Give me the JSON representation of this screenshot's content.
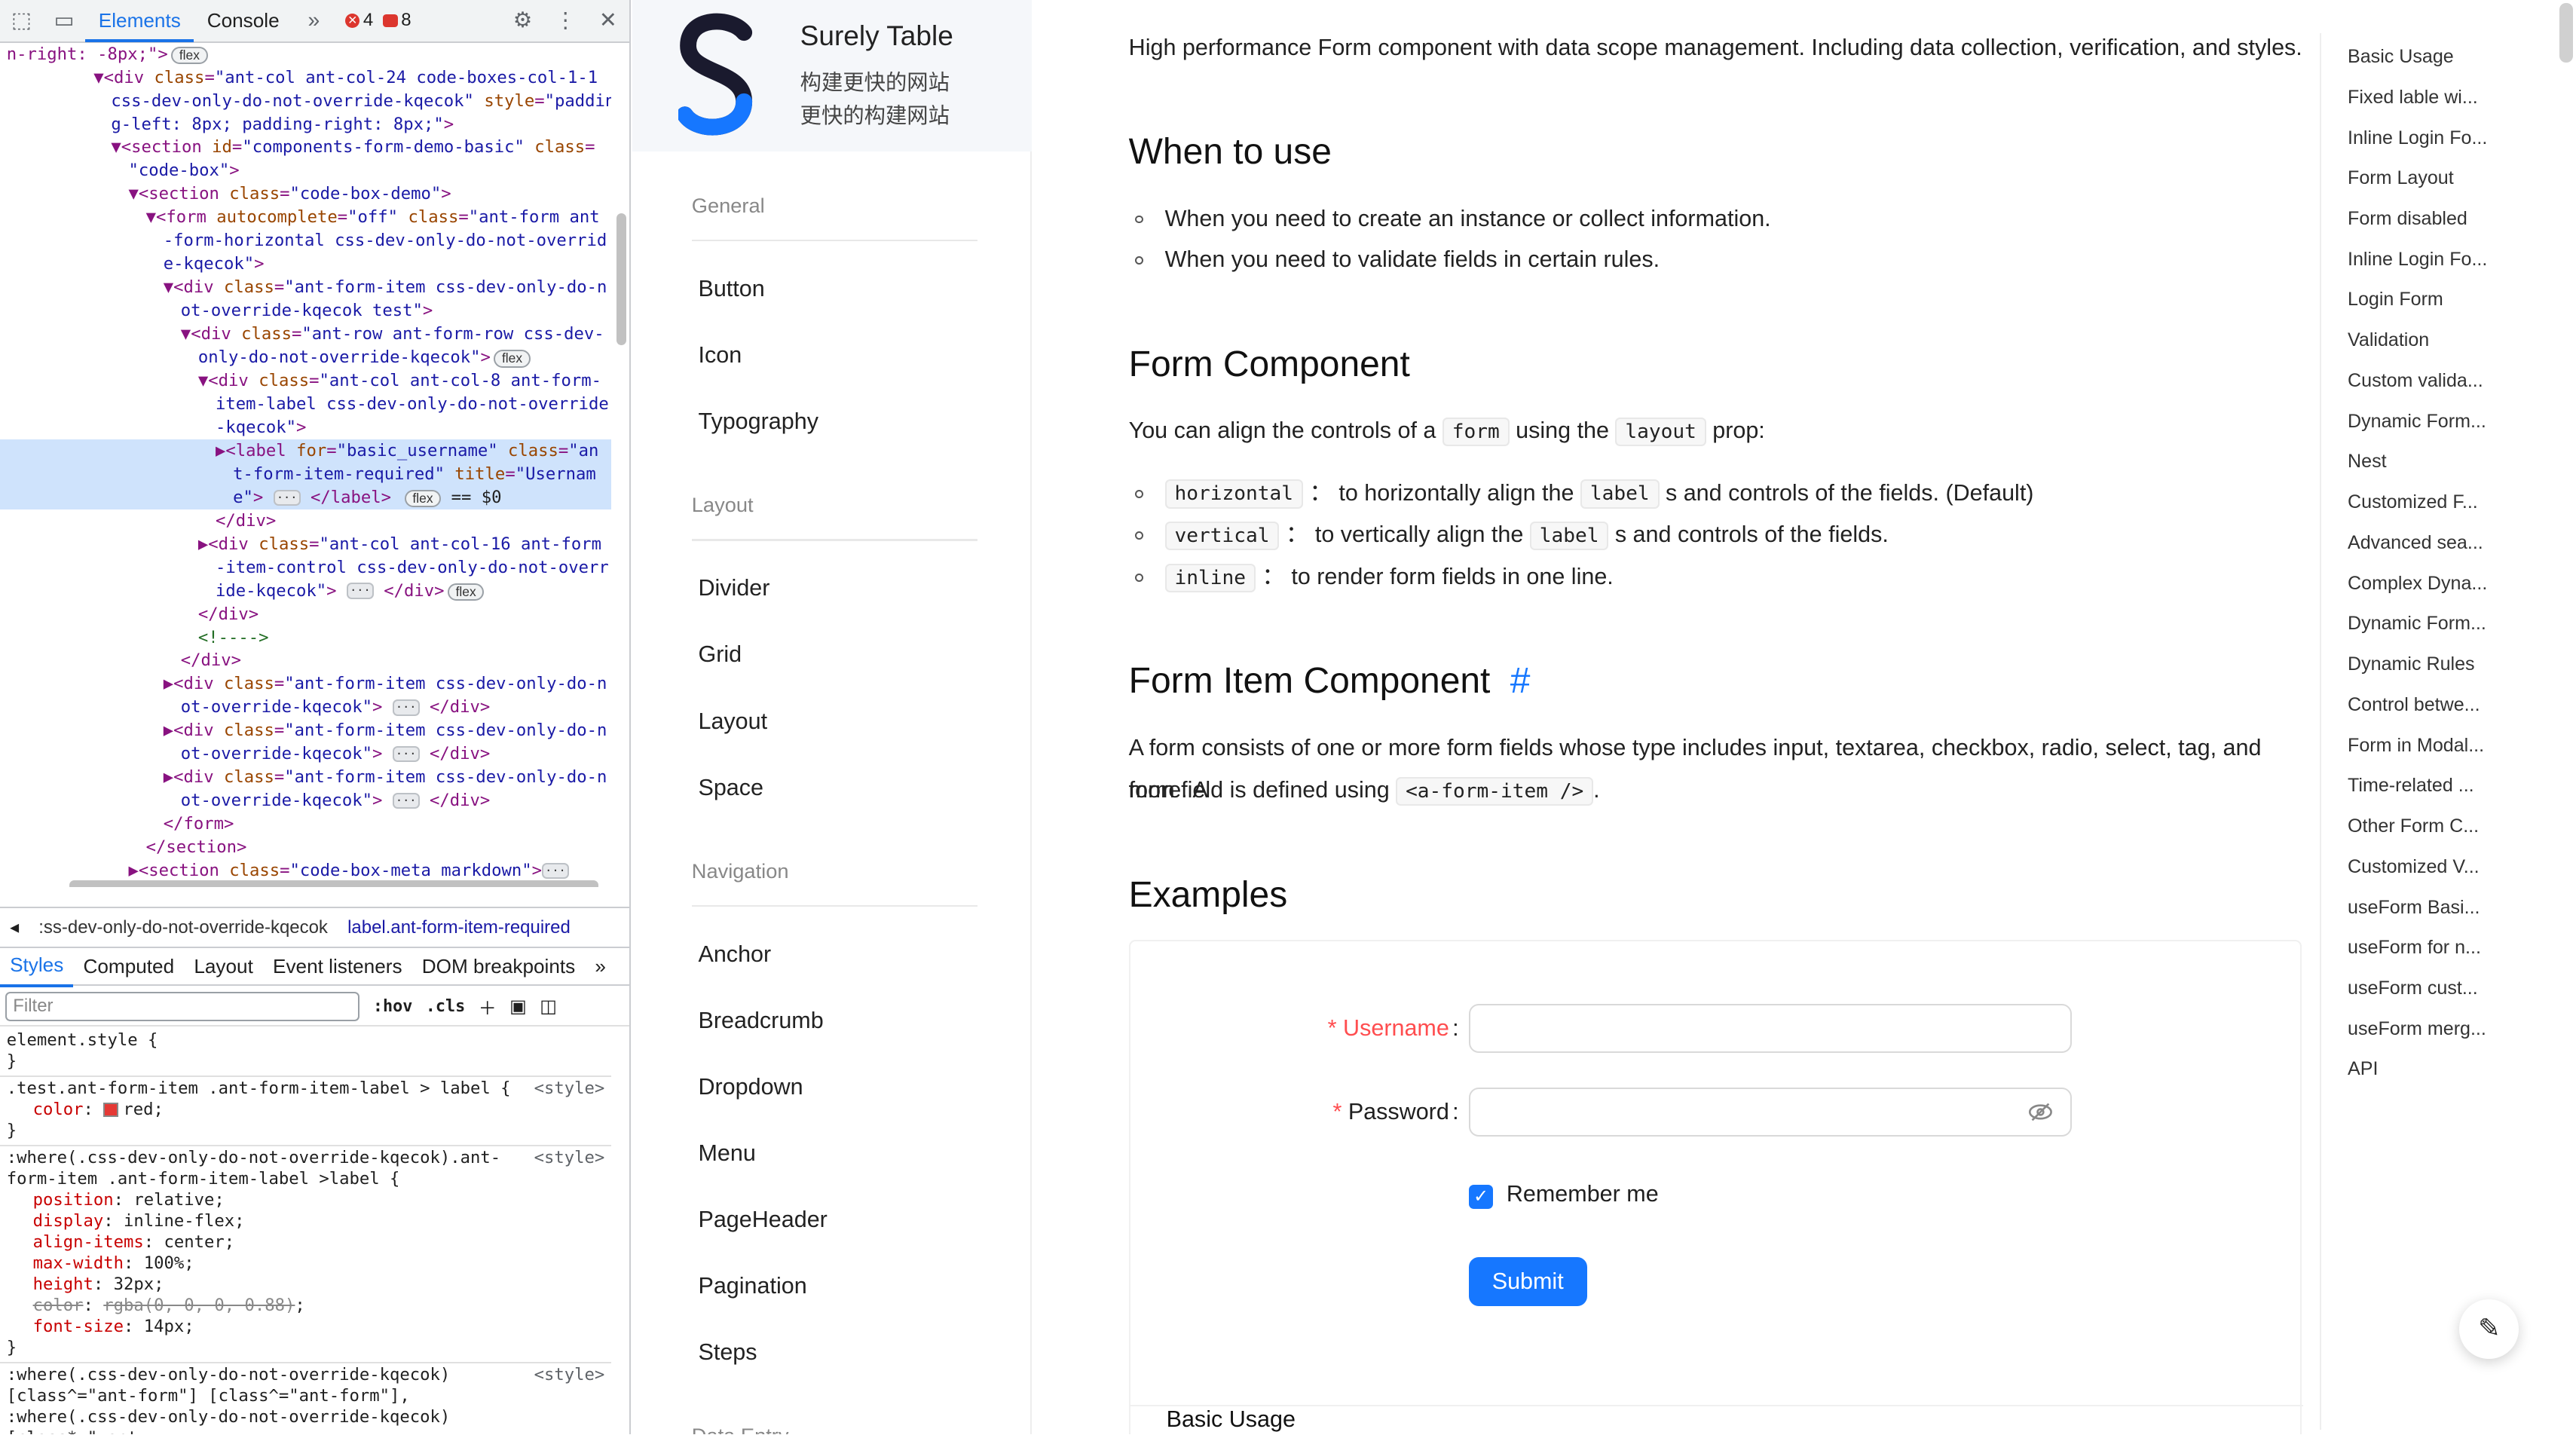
{
  "devtools": {
    "tabs": [
      "Elements",
      "Console"
    ],
    "more_tabs_icon": "»",
    "error_count": "4",
    "message_count": "8",
    "dom_lines": [
      {
        "indent": 0,
        "html": "<span class='tg'>n-right: -8px;\"></span><span class='pill'>flex</span>"
      },
      {
        "indent": 5,
        "html": "▼<span class='tg'>&lt;div</span> <span class='at'>class</span>=<span class='av'>\"ant-col ant-col-24 code-boxes-col-1-1</span>"
      },
      {
        "indent": 6,
        "html": "<span class='av'>css-dev-only-do-not-override-kqecok\"</span> <span class='at'>style</span>=<span class='av'>\"paddin</span>"
      },
      {
        "indent": 6,
        "html": "<span class='av'>g-left: 8px; padding-right: 8px;\"</span><span class='tg'>&gt;</span>"
      },
      {
        "indent": 6,
        "html": "▼<span class='tg'>&lt;section</span> <span class='at'>id</span>=<span class='av'>\"components-form-demo-basic\"</span> <span class='at'>class</span>="
      },
      {
        "indent": 7,
        "html": "<span class='av'>\"code-box\"</span><span class='tg'>&gt;</span>"
      },
      {
        "indent": 7,
        "html": "▼<span class='tg'>&lt;section</span> <span class='at'>class</span>=<span class='av'>\"code-box-demo\"</span><span class='tg'>&gt;</span>"
      },
      {
        "indent": 8,
        "html": "▼<span class='tg'>&lt;form</span> <span class='at'>autocomplete</span>=<span class='av'>\"off\"</span> <span class='at'>class</span>=<span class='av'>\"ant-form ant</span>"
      },
      {
        "indent": 9,
        "html": "<span class='av'>-form-horizontal css-dev-only-do-not-overrid</span>"
      },
      {
        "indent": 9,
        "html": "<span class='av'>e-kqecok\"</span><span class='tg'>&gt;</span>"
      },
      {
        "indent": 9,
        "html": "▼<span class='tg'>&lt;div</span> <span class='at'>class</span>=<span class='av'>\"ant-form-item css-dev-only-do-n</span>"
      },
      {
        "indent": 10,
        "html": "<span class='av'>ot-override-kqecok test\"</span><span class='tg'>&gt;</span>"
      },
      {
        "indent": 10,
        "html": "▼<span class='tg'>&lt;div</span> <span class='at'>class</span>=<span class='av'>\"ant-row ant-form-row css-dev-</span>"
      },
      {
        "indent": 11,
        "html": "<span class='av'>only-do-not-override-kqecok\"</span><span class='tg'>&gt;</span><span class='pill'>flex</span>"
      },
      {
        "indent": 11,
        "html": "▼<span class='tg'>&lt;div</span> <span class='at'>class</span>=<span class='av'>\"ant-col ant-col-8 ant-form-</span>"
      },
      {
        "indent": 12,
        "html": "<span class='av'>item-label css-dev-only-do-not-override</span>"
      },
      {
        "indent": 12,
        "html": "<span class='av'>-kqecok\"</span><span class='tg'>&gt;</span>"
      },
      {
        "indent": 12,
        "sel": true,
        "html": "▶<span class='tg'>&lt;label</span> <span class='at'>for</span>=<span class='av'>\"basic_username\"</span> <span class='at'>class</span>=<span class='av'>\"an</span>"
      },
      {
        "indent": 13,
        "sel": true,
        "html": "<span class='av'>t-form-item-required\"</span> <span class='at'>title</span>=<span class='av'>\"Usernam</span>"
      },
      {
        "indent": 13,
        "sel": true,
        "html": "<span class='av'>e\"</span><span class='tg'>&gt;</span> <span class='dots'>···</span> <span class='tg'>&lt;/label&gt;</span> <span class='pill'>flex</span> <span class='tx'>== $0</span>"
      },
      {
        "indent": 12,
        "html": "<span class='tg'>&lt;/div&gt;</span>"
      },
      {
        "indent": 11,
        "html": "▶<span class='tg'>&lt;div</span> <span class='at'>class</span>=<span class='av'>\"ant-col ant-col-16 ant-form</span>"
      },
      {
        "indent": 12,
        "html": "<span class='av'>-item-control css-dev-only-do-not-overr</span>"
      },
      {
        "indent": 12,
        "html": "<span class='av'>ide-kqecok\"</span><span class='tg'>&gt;</span> <span class='dots'>···</span> <span class='tg'>&lt;/div&gt;</span><span class='pill'>flex</span>"
      },
      {
        "indent": 11,
        "html": "<span class='tg'>&lt;/div&gt;</span>"
      },
      {
        "indent": 11,
        "html": "<span class='cm'>&lt;!----&gt;</span>"
      },
      {
        "indent": 10,
        "html": "<span class='tg'>&lt;/div&gt;</span>"
      },
      {
        "indent": 9,
        "html": "▶<span class='tg'>&lt;div</span> <span class='at'>class</span>=<span class='av'>\"ant-form-item css-dev-only-do-n</span>"
      },
      {
        "indent": 10,
        "html": "<span class='av'>ot-override-kqecok\"</span><span class='tg'>&gt;</span> <span class='dots'>···</span> <span class='tg'>&lt;/div&gt;</span>"
      },
      {
        "indent": 9,
        "html": "▶<span class='tg'>&lt;div</span> <span class='at'>class</span>=<span class='av'>\"ant-form-item css-dev-only-do-n</span>"
      },
      {
        "indent": 10,
        "html": "<span class='av'>ot-override-kqecok\"</span><span class='tg'>&gt;</span> <span class='dots'>···</span> <span class='tg'>&lt;/div&gt;</span>"
      },
      {
        "indent": 9,
        "html": "▶<span class='tg'>&lt;div</span> <span class='at'>class</span>=<span class='av'>\"ant-form-item css-dev-only-do-n</span>"
      },
      {
        "indent": 10,
        "html": "<span class='av'>ot-override-kqecok\"</span><span class='tg'>&gt;</span> <span class='dots'>···</span> <span class='tg'>&lt;/div&gt;</span>"
      },
      {
        "indent": 9,
        "html": "<span class='tg'>&lt;/form&gt;</span>"
      },
      {
        "indent": 8,
        "html": "<span class='tg'>&lt;/section&gt;</span>"
      },
      {
        "indent": 7,
        "html": "▶<span class='tg'>&lt;section</span> <span class='at'>class</span>=<span class='av'>\"code-box-meta markdown\"</span><span class='tg'>&gt;</span><span class='dots'>···</span>"
      },
      {
        "indent": 8,
        "html": "<span class='tg'>&lt;/section&gt;</span>"
      }
    ],
    "breadcrumb": [
      ":ss-dev-only-do-not-override-kqecok",
      "label.ant-form-item-required"
    ],
    "styles_tabs": [
      "Styles",
      "Computed",
      "Layout",
      "Event listeners",
      "DOM breakpoints"
    ],
    "filter_placeholder": "Filter",
    "hov": ":hov",
    "cls": ".cls",
    "rules": [
      {
        "selector": "element.style {",
        "src": "",
        "props": [],
        "close": "}"
      },
      {
        "selector": ".test.ant-form-item .ant-form-item-label > label {",
        "src": "<style>",
        "props": [
          {
            "n": "color",
            "v": "red",
            "sw": "#e53935"
          }
        ],
        "close": "}"
      },
      {
        "selector": ":where(.css-dev-only-do-not-override-kqecok).ant-form-item .ant-form-item-label >label {",
        "src": "<style>",
        "props": [
          {
            "n": "position",
            "v": "relative"
          },
          {
            "n": "display",
            "v": "inline-flex"
          },
          {
            "n": "align-items",
            "v": "center"
          },
          {
            "n": "max-width",
            "v": "100%"
          },
          {
            "n": "height",
            "v": "32px"
          },
          {
            "n": "color",
            "v": "rgba(0, 0, 0, 0.88)",
            "strike": true
          },
          {
            "n": "font-size",
            "v": "14px"
          }
        ],
        "close": "}"
      },
      {
        "selector": ":where(.css-dev-only-do-not-override-kqecok) [class^=\"ant-form\"] [class^=\"ant-form\"], :where(.css-dev-only-do-not-override-kqecok)[class*=\" ant-",
        "src": "<style>",
        "props": [],
        "close": ""
      }
    ]
  },
  "site": {
    "title": "Surely Table",
    "subtitle1": "构建更快的网站",
    "subtitle2": "更快的构建网站",
    "nav": [
      {
        "group": "General",
        "items": [
          "Button",
          "Icon",
          "Typography"
        ]
      },
      {
        "group": "Layout",
        "items": [
          "Divider",
          "Grid",
          "Layout",
          "Space"
        ]
      },
      {
        "group": "Navigation",
        "items": [
          "Anchor",
          "Breadcrumb",
          "Dropdown",
          "Menu",
          "PageHeader",
          "Pagination",
          "Steps"
        ]
      },
      {
        "group": "Data Entry",
        "items": []
      }
    ]
  },
  "doc": {
    "intro": "High performance Form component with data scope management. Including data collection, verification, and styles.",
    "h_when": "When to use",
    "when": [
      "When you need to create an instance or collect information.",
      "When you need to validate fields in certain rules."
    ],
    "h_form": "Form Component",
    "align_pre": "You can align the controls of a",
    "code_form": "form",
    "align_mid": "using the",
    "code_layout": "layout",
    "align_post": "prop:",
    "layouts": [
      {
        "code": "horizontal",
        "sep": "：",
        "pre": "to horizontally align the",
        "code2": "label",
        "post": "s and controls of the fields. (Default)"
      },
      {
        "code": "vertical",
        "sep": "：",
        "pre": "to vertically align the",
        "code2": "label",
        "post": "s and controls of the fields."
      },
      {
        "code": "inline",
        "sep": "：",
        "pre": "to render form fields in one line.",
        "code2": "",
        "post": ""
      }
    ],
    "h_item": "Form Item Component",
    "hash": "#",
    "item_p1": "A form consists of one or more form fields whose type includes input, textarea, checkbox, radio, select, tag, and more. A",
    "item_p2": "form field is defined using",
    "item_code": "<a-form-item />",
    "item_end": ".",
    "h_examples": "Examples",
    "form": {
      "star": "*",
      "username": "Username",
      "password": "Password",
      "colon": ":",
      "remember": "Remember me",
      "submit": "Submit",
      "check": "✓"
    },
    "basic_usage": "Basic Usage"
  },
  "toc": [
    "Basic Usage",
    "Fixed lable wi...",
    "Inline Login Fo...",
    "Form Layout",
    "Form disabled",
    "Inline Login Fo...",
    "Login Form",
    "Validation",
    "Custom valida...",
    "Dynamic Form...",
    "Nest",
    "Customized F...",
    "Advanced sea...",
    "Complex Dyna...",
    "Dynamic Form...",
    "Dynamic Rules",
    "Control betwe...",
    "Form in Modal...",
    "Time-related ...",
    "Other Form C...",
    "Customized V...",
    "useForm Basi...",
    "useForm for n...",
    "useForm cust...",
    "useForm merg...",
    "API"
  ],
  "colors": {
    "accent": "#1677ff",
    "required": "#ff4d4f",
    "devtools_blue": "#1a73e8"
  }
}
